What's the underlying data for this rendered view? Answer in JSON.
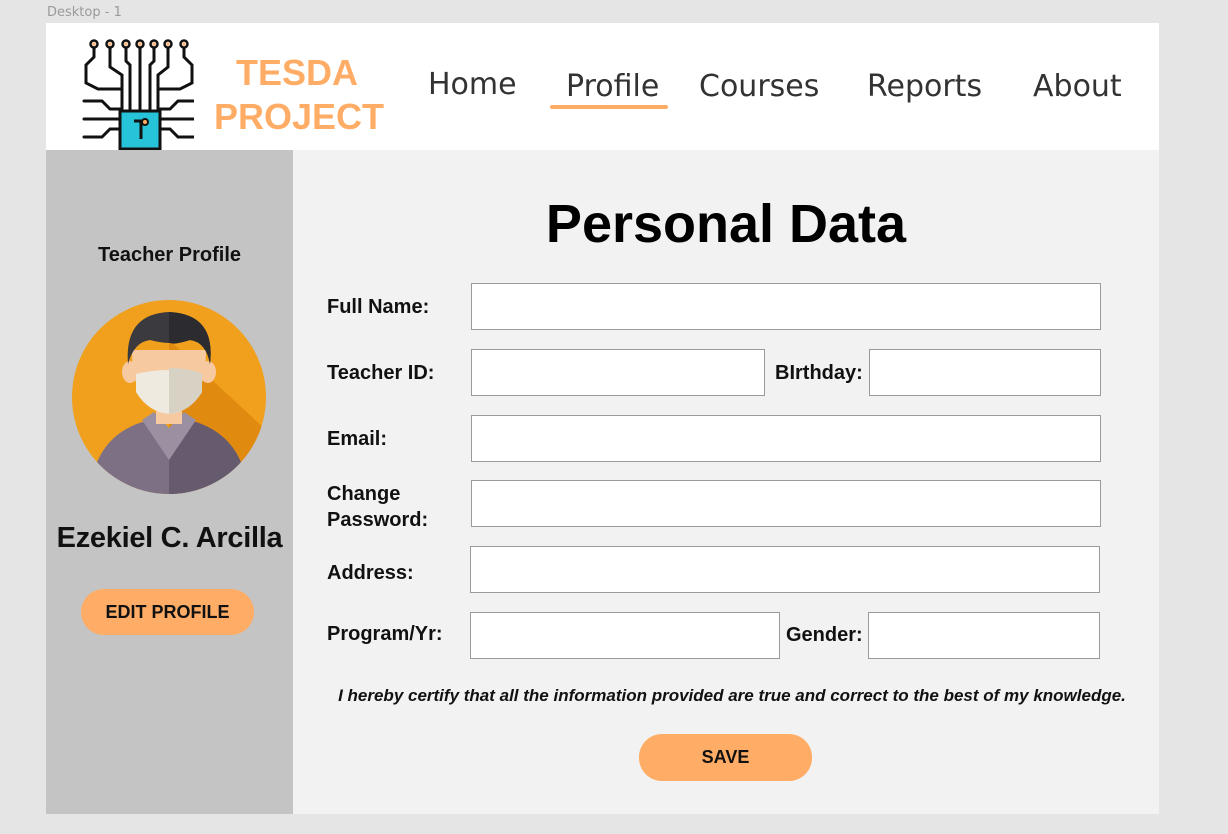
{
  "canvas": {
    "frame_label": "Desktop - 1"
  },
  "brand": {
    "line1": "TESDA",
    "line2": "PROJECT",
    "logo_icon": "circuit-chip-icon",
    "accent_color": "#ffad66"
  },
  "nav": {
    "items": [
      {
        "label": "Home"
      },
      {
        "label": "Profile",
        "active": true
      },
      {
        "label": "Courses"
      },
      {
        "label": "Reports"
      },
      {
        "label": "About"
      }
    ]
  },
  "sidebar": {
    "title": "Teacher Profile",
    "avatar_icon": "masked-teacher-avatar-icon",
    "user_name": "Ezekiel C. Arcilla",
    "edit_button": "EDIT PROFILE"
  },
  "form": {
    "title": "Personal Data",
    "full_name_label": "Full Name:",
    "full_name_value": "",
    "teacher_id_label": "Teacher ID:",
    "teacher_id_value": "",
    "birthday_label": "BIrthday:",
    "birthday_value": "",
    "email_label": "Email:",
    "email_value": "",
    "change_password_label_1": "Change",
    "change_password_label_2": "Password:",
    "change_password_value": "",
    "address_label": "Address:",
    "address_value": "",
    "program_label": "Program/Yr:",
    "program_value": "",
    "gender_label": "Gender:",
    "gender_value": "",
    "certification": "I hereby certify that all the information provided are true and correct to the best of my knowledge.",
    "save_button": "SAVE"
  }
}
